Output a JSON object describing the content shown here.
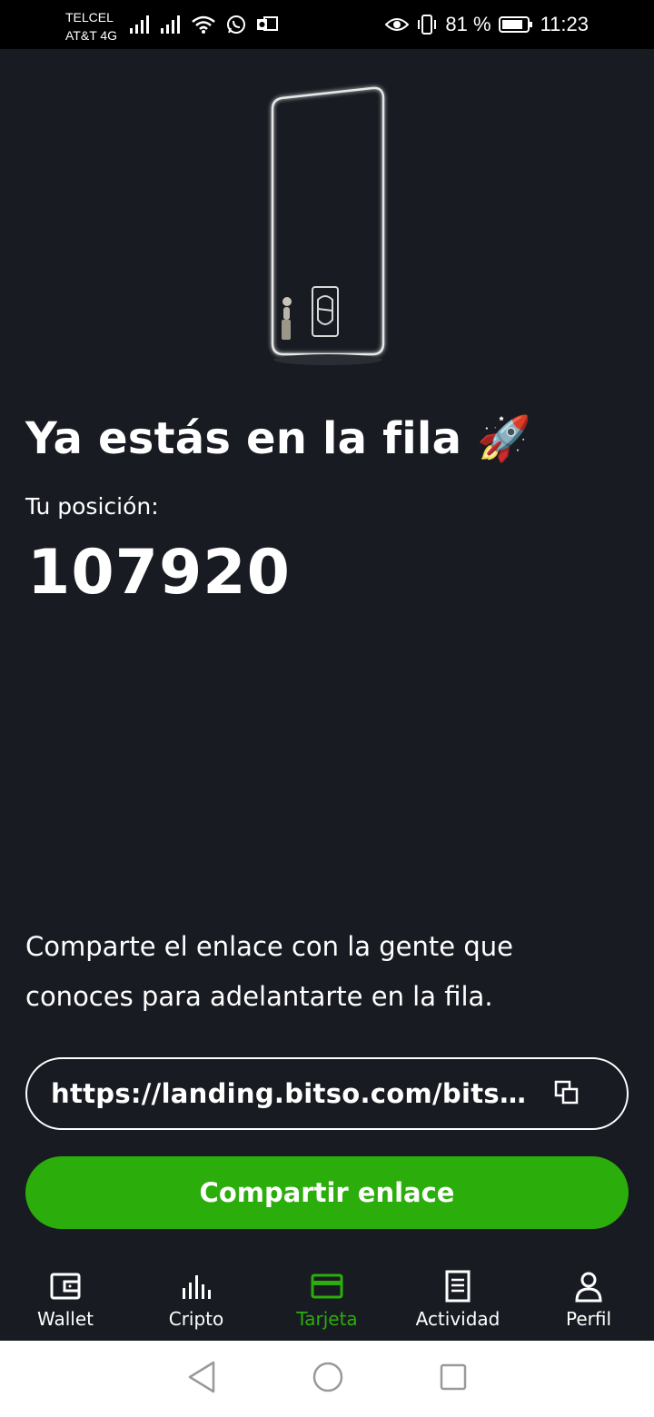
{
  "status_bar": {
    "carrier_1": "TELCEL",
    "carrier_2": "AT&T 4G",
    "battery": "81 %",
    "time": "11:23",
    "icons": [
      "signal-icon",
      "signal-icon",
      "wifi-icon",
      "whatsapp-icon",
      "outlook-icon",
      "eye-icon",
      "vibrate-icon",
      "battery-icon"
    ]
  },
  "main": {
    "headline": "Ya estás en la fila 🚀",
    "position_label": "Tu posición:",
    "position_value": "107920",
    "share_text": "Comparte el enlace con la gente que conoces para adelantarte en la fila.",
    "link_value": "https://landing.bitso.com/bitso-card-waitlist",
    "share_button": "Compartir enlace"
  },
  "bottom_nav": {
    "items": [
      {
        "label": "Wallet",
        "icon": "wallet-icon",
        "active": false
      },
      {
        "label": "Cripto",
        "icon": "chart-icon",
        "active": false
      },
      {
        "label": "Tarjeta",
        "icon": "card-icon",
        "active": true
      },
      {
        "label": "Actividad",
        "icon": "activity-icon",
        "active": false
      },
      {
        "label": "Perfil",
        "icon": "profile-icon",
        "active": false
      }
    ]
  },
  "colors": {
    "background": "#181c22",
    "accent": "#2bad0b",
    "text": "#ffffff"
  }
}
